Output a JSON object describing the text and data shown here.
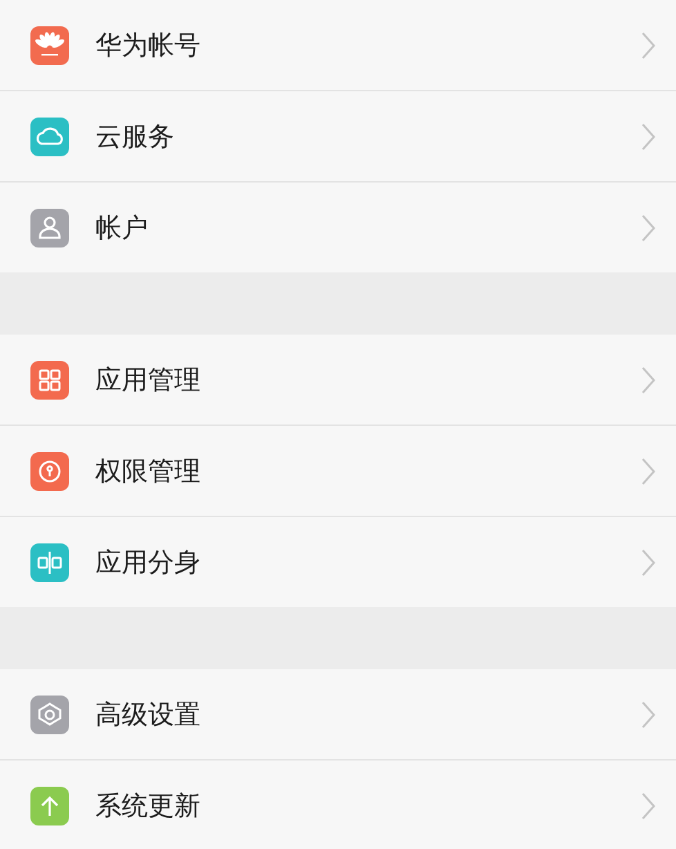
{
  "groups": [
    {
      "items": [
        {
          "label": "华为帐号",
          "kind": "petals",
          "color": "#f26b4f"
        },
        {
          "label": "云服务",
          "kind": "cloud",
          "color": "#2bbfc4"
        },
        {
          "label": "帐户",
          "kind": "person",
          "color": "#a4a4aa"
        }
      ]
    },
    {
      "items": [
        {
          "label": "应用管理",
          "kind": "grid",
          "color": "#f36a4e"
        },
        {
          "label": "权限管理",
          "kind": "keyhole",
          "color": "#f36a4e"
        },
        {
          "label": "应用分身",
          "kind": "split",
          "color": "#2bbfc4"
        }
      ]
    },
    {
      "items": [
        {
          "label": "高级设置",
          "kind": "gear",
          "color": "#a4a4aa"
        },
        {
          "label": "系统更新",
          "kind": "arrow",
          "color": "#8bcb4f"
        }
      ]
    }
  ]
}
